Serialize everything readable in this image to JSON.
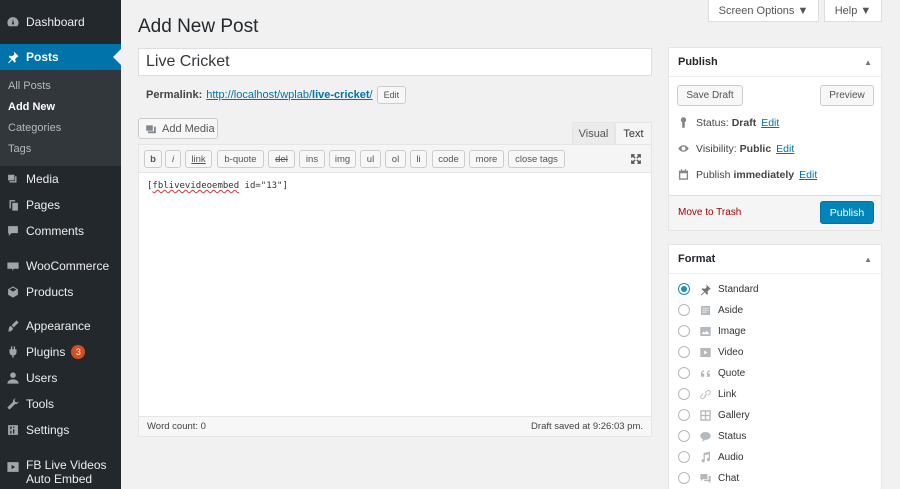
{
  "sidebar": {
    "dashboard": "Dashboard",
    "posts": "Posts",
    "posts_sub": [
      "All Posts",
      "Add New",
      "Categories",
      "Tags"
    ],
    "media": "Media",
    "pages": "Pages",
    "comments": "Comments",
    "woocommerce": "WooCommerce",
    "products": "Products",
    "appearance": "Appearance",
    "plugins": "Plugins",
    "plugins_badge": "3",
    "users": "Users",
    "tools": "Tools",
    "settings": "Settings",
    "fb_live_1": "FB Live Videos",
    "fb_live_2": "Auto Embed"
  },
  "header": {
    "screen_options": "Screen Options ▼",
    "help": "Help ▼",
    "page_title": "Add New Post"
  },
  "post": {
    "title": "Live Cricket",
    "permalink_label": "Permalink:",
    "permalink_base": "http://localhost/wplab/",
    "permalink_slug": "live-cricket",
    "permalink_end": "/",
    "edit_btn": "Edit"
  },
  "editor": {
    "add_media": "Add Media",
    "tab_visual": "Visual",
    "tab_text": "Text",
    "toolbar": [
      "b",
      "i",
      "link",
      "b-quote",
      "del",
      "ins",
      "img",
      "ul",
      "ol",
      "li",
      "code",
      "more",
      "close tags"
    ],
    "content_part1": "[",
    "content_misspelled": "fblivevideoembed",
    "content_part2": " id=\"13\"]",
    "word_count": "Word count: 0",
    "draft_saved": "Draft saved at 9:26:03 pm."
  },
  "publish": {
    "title": "Publish",
    "save_draft": "Save Draft",
    "preview": "Preview",
    "status_label": "Status:",
    "status_value": "Draft",
    "status_edit": "Edit",
    "visibility_label": "Visibility:",
    "visibility_value": "Public",
    "visibility_edit": "Edit",
    "publish_label": "Publish",
    "publish_value": "immediately",
    "publish_edit": "Edit",
    "trash": "Move to Trash",
    "publish_btn": "Publish"
  },
  "format": {
    "title": "Format",
    "options": [
      "Standard",
      "Aside",
      "Image",
      "Video",
      "Quote",
      "Link",
      "Gallery",
      "Status",
      "Audio",
      "Chat"
    ],
    "selected": "Standard"
  },
  "colors": {
    "sidebar_bg": "#23282d",
    "accent": "#0073aa",
    "publish_btn": "#0085ba",
    "trash": "#aa0000"
  }
}
